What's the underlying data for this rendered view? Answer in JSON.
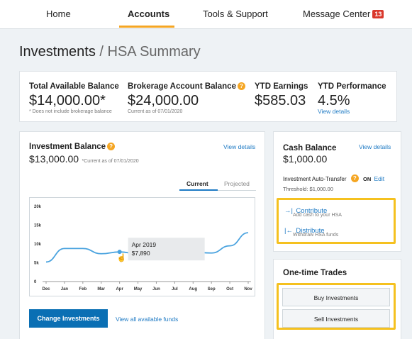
{
  "nav": {
    "items": [
      {
        "label": "Home"
      },
      {
        "label": "Accounts"
      },
      {
        "label": "Tools & Support"
      },
      {
        "label": "Message Center"
      }
    ],
    "message_count": "13",
    "active": "Accounts"
  },
  "breadcrumb": {
    "title": "Investments",
    "separator": "/",
    "subtitle": "HSA Summary"
  },
  "summary": {
    "total_label": "Total Available Balance",
    "total_value": "$14,000.00*",
    "total_note": "* Does not include brokerage balance",
    "brokerage_label": "Brokerage Account Balance",
    "brokerage_value": "$24,000.00",
    "brokerage_note": "Current as of 07/01/2020",
    "ytd_earnings_label": "YTD Earnings",
    "ytd_earnings_value": "$585.03",
    "ytd_perf_label": "YTD Performance",
    "ytd_perf_value": "4.5%",
    "ytd_perf_link": "View details"
  },
  "investment": {
    "label": "Investment Balance",
    "value": "$13,000.00",
    "note": "*Current as of 07/01/2020",
    "view_details": "View details",
    "tabs": [
      "Current",
      "Projected"
    ],
    "tooltip_date": "Apr 2019",
    "tooltip_value": "$7,890",
    "change_button": "Change Investments",
    "all_funds_link": "View all available funds"
  },
  "chart_data": {
    "type": "line",
    "categories": [
      "Dec",
      "Jan",
      "Feb",
      "Mar",
      "Apr",
      "May",
      "Jun",
      "Jul",
      "Aug",
      "Sep",
      "Oct",
      "Nov"
    ],
    "y_ticks": [
      "20k",
      "15k",
      "10k",
      "5k",
      "0"
    ],
    "ylim": [
      0,
      20000
    ],
    "series": [
      {
        "values": [
          5200,
          8800,
          8800,
          7400,
          7890,
          7400,
          7400,
          7800,
          7800,
          7600,
          9500,
          13000
        ]
      }
    ],
    "highlight_index": 4,
    "grid": false
  },
  "cash": {
    "label": "Cash Balance",
    "value": "$1,000.00",
    "view_details": "View details",
    "auto_transfer_label": "Investment Auto-Transfer",
    "auto_transfer_state": "ON",
    "edit_link": "Edit",
    "threshold": "Threshold: $1,000.00",
    "contribute_label": "Contribute",
    "contribute_desc": "Add cash to your HSA",
    "distribute_label": "Distribute",
    "distribute_desc": "Withdraw HSA funds"
  },
  "trades": {
    "title": "One-time Trades",
    "buy_button": "Buy Investments",
    "sell_button": "Sell Investments"
  },
  "colors": {
    "accent": "#f5a623",
    "link": "#1e7ac4",
    "primary_button": "#0a6fb4",
    "line": "#4aa3df",
    "highlight_box": "#f5c11f",
    "badge": "#d9382c"
  }
}
